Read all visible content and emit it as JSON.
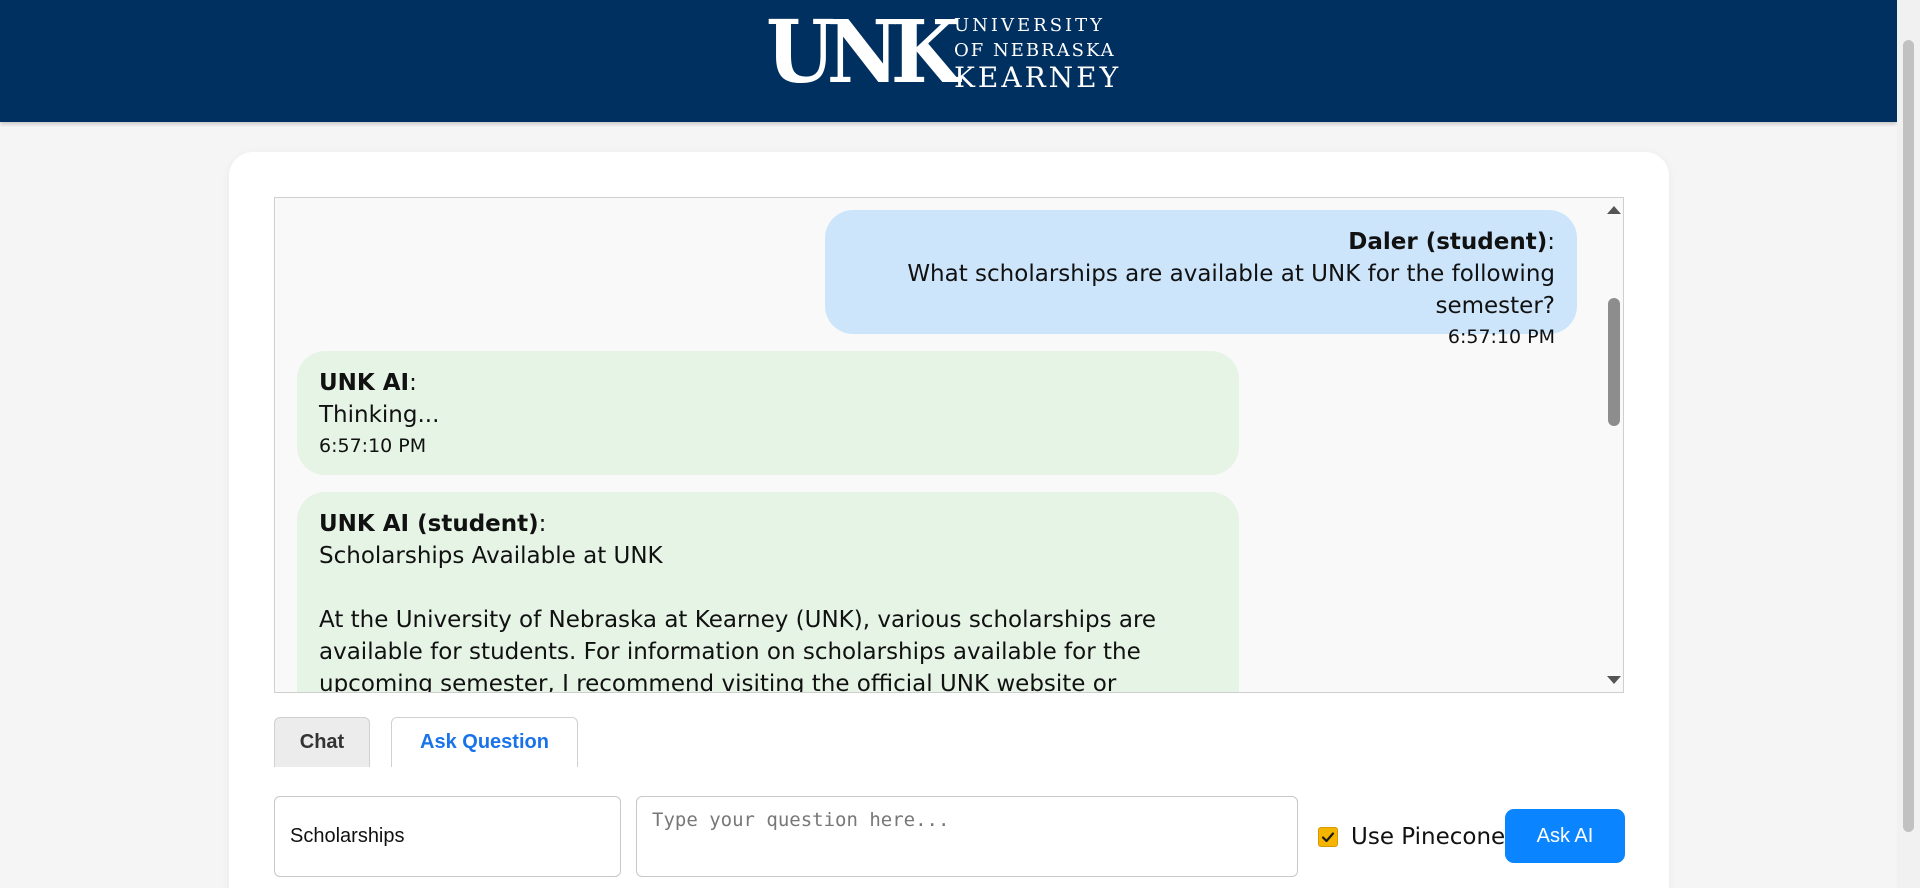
{
  "header": {
    "logo_mark": "UNK",
    "logo_line1": "UNIVERSITY",
    "logo_line2": "OF NEBRASKA",
    "logo_line3": "KEARNEY",
    "bg_color": "#00305f"
  },
  "chat": {
    "messages": [
      {
        "sender": "Daler (student)",
        "text": "What scholarships are available at UNK for the following semester?",
        "time": "6:57:10 PM",
        "role": "user",
        "color": "#cde5fb"
      },
      {
        "sender": "UNK AI",
        "text": "Thinking...",
        "time": "6:57:10 PM",
        "role": "ai",
        "color": "#e6f4e6"
      },
      {
        "sender": "UNK AI (student)",
        "title": "Scholarships Available at UNK",
        "text": "At the University of Nebraska at Kearney (UNK), various scholarships are available for students. For information on scholarships available for the upcoming semester, I recommend visiting the official UNK website or contacting the Financial Aid Office",
        "role": "ai",
        "color": "#e6f4e6"
      }
    ]
  },
  "tabs": [
    {
      "label": "Chat",
      "active": false
    },
    {
      "label": "Ask Question",
      "active": true
    }
  ],
  "controls": {
    "subject_value": "Scholarships",
    "question_placeholder": "Type your question here...",
    "question_value": "",
    "pinecone_label": "Use Pinecone",
    "pinecone_checked": true,
    "ask_button_label": "Ask AI"
  },
  "colors": {
    "accent": "#0a84ff",
    "checkbox": "#f5b400",
    "tab_active_text": "#1a73e8"
  }
}
